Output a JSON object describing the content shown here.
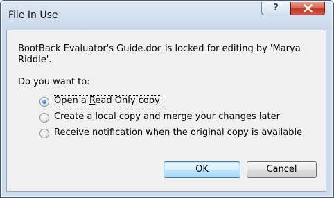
{
  "window": {
    "title": "File In Use",
    "help_glyph": "?",
    "close_icon": "close-x-icon"
  },
  "message": "BootBack Evaluator's Guide.doc is locked for editing by 'Marya Riddle'.",
  "question": "Do you want to:",
  "options": [
    {
      "label_pre": "Open a ",
      "accel": "R",
      "label_post": "ead Only copy",
      "selected": true
    },
    {
      "label_pre": "Create a local copy and ",
      "accel": "m",
      "label_post": "erge your changes later",
      "selected": false
    },
    {
      "label_pre": "Receive ",
      "accel": "n",
      "label_post": "otification when the original copy is available",
      "selected": false
    }
  ],
  "buttons": {
    "ok_label": "OK",
    "cancel_label": "Cancel"
  },
  "colors": {
    "close_button": "#c0392b",
    "default_button_border": "#3c7fb1",
    "radio_selected": "#2a7fd4"
  }
}
